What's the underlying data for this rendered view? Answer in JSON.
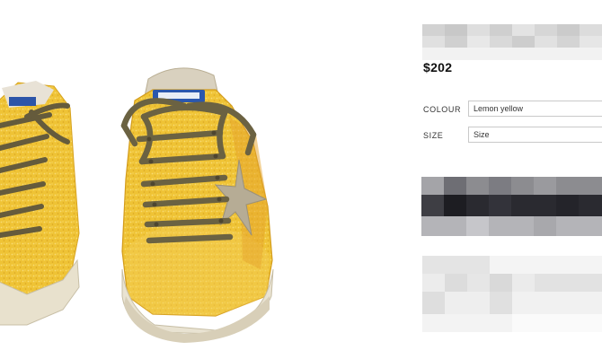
{
  "product": {
    "price": "$202",
    "image_alt": "yellow glitter sneakers"
  },
  "options": {
    "colour_label": "COLOUR",
    "colour_value": "Lemon yellow",
    "size_label": "SIZE",
    "size_value": "Size"
  },
  "obscured": {
    "title": "redacted product name",
    "add_to_bag": "redacted add to bag button",
    "details": "redacted product details"
  },
  "colors": {
    "shoe_yellow": "#f0c232",
    "lace": "#6b6242",
    "sole": "#e9e3d2",
    "star": "#b8ad96",
    "button_dark": "#2a2a30"
  }
}
